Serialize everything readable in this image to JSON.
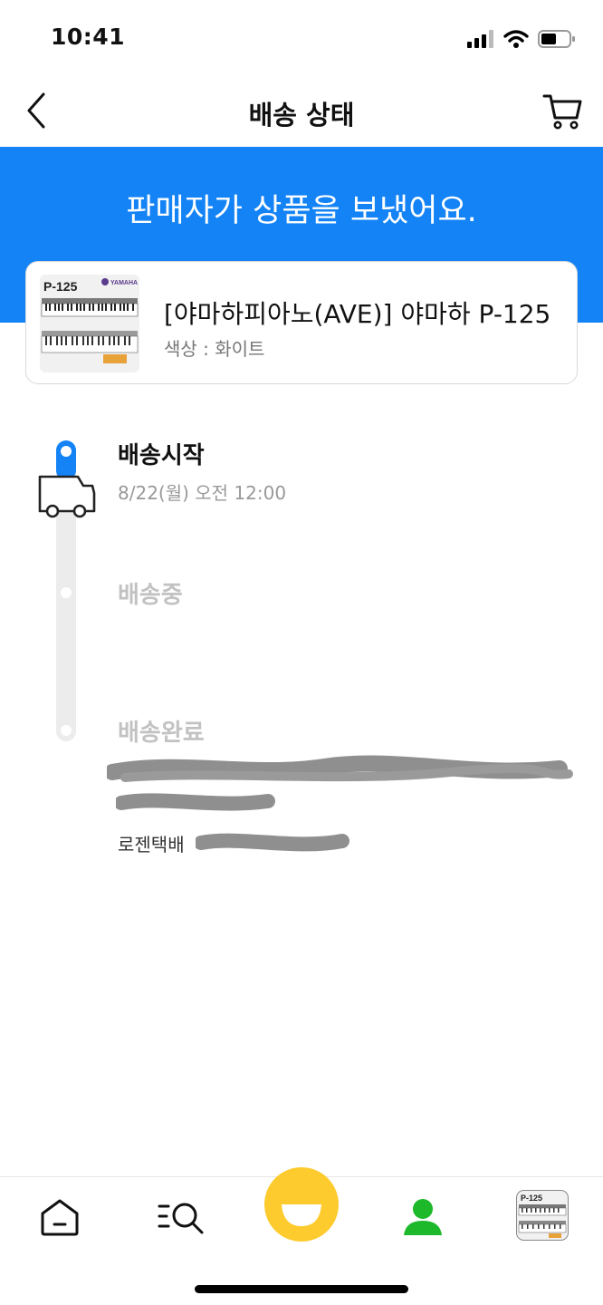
{
  "status_bar": {
    "time": "10:41"
  },
  "nav": {
    "title": "배송 상태"
  },
  "banner": {
    "message": "판매자가 상품을 보냈어요."
  },
  "product": {
    "title": "[야마하피아노(AVE)] 야마하 P-125",
    "option": "색상 : 화이트",
    "thumb_model": "P-125",
    "thumb_brand": "YAMAHA"
  },
  "timeline": {
    "steps": [
      {
        "label": "배송시작",
        "date": "8/22(월) 오전 12:00",
        "active": true
      },
      {
        "label": "배송중",
        "active": false
      },
      {
        "label": "배송완료",
        "active": false
      }
    ],
    "courier": "로젠택배"
  },
  "colors": {
    "accent": "#1383F6",
    "profile_green": "#1DB92B",
    "inactive_text": "#C2C2C2"
  },
  "tabs": [
    {
      "icon": "home-icon"
    },
    {
      "icon": "search-list-icon"
    },
    {
      "icon": "smile-center-icon"
    },
    {
      "icon": "profile-icon"
    },
    {
      "icon": "product-thumb-icon"
    }
  ]
}
